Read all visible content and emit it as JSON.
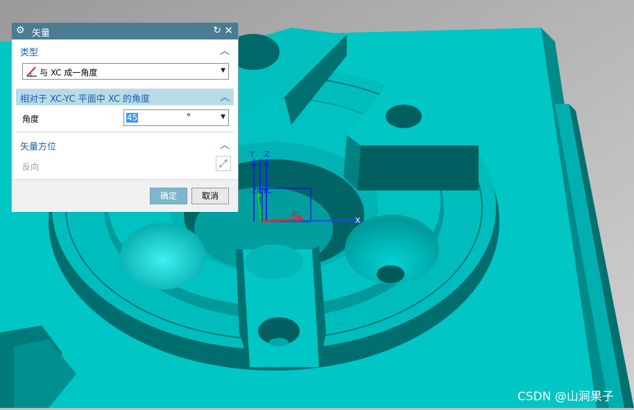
{
  "dialog": {
    "title": "矢量",
    "icons": {
      "settings": "gear-icon",
      "reset": "reset-icon",
      "close": "close-icon"
    },
    "type_section": {
      "label": "类型",
      "selected": "与 XC 成一角度",
      "icon": "angle-vector-icon"
    },
    "angle_section": {
      "label": "相对于 XC-YC 平面中 XC 的角度",
      "field_label": "角度",
      "value": "45",
      "unit": "°"
    },
    "orientation_section": {
      "label": "矢量方位",
      "reverse_label": "反向",
      "reverse_icon": "reverse-direction-icon"
    },
    "buttons": {
      "ok": "确定",
      "cancel": "取消"
    }
  },
  "triad": {
    "y_label": "Y",
    "z_label": "Z",
    "zc_label": "ZC",
    "yc_label": "YC",
    "xc_label": "XC",
    "x_label": "X"
  },
  "watermark": "CSDN @山涧果子",
  "colors": {
    "model_face": "#00bebe",
    "model_side": "#008080",
    "model_dark": "#005a5a",
    "dialog_title": "#4a7c94",
    "section_active": "#b8dbe9",
    "accent": "#1b5fa5"
  }
}
